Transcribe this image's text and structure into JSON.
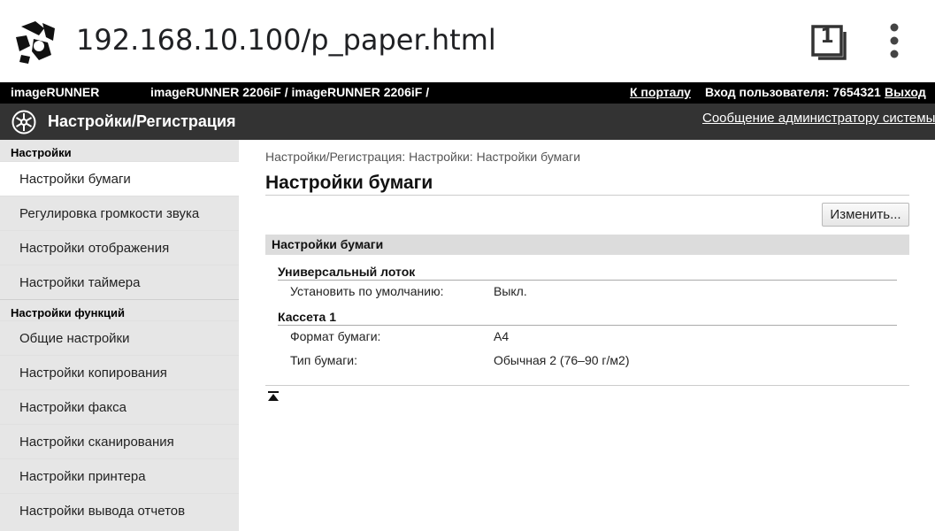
{
  "browser": {
    "url": "192.168.10.100/p_paper.html",
    "tab_count": "1",
    "site_icon": "site-favicon",
    "tabs_icon": "tabs-icon",
    "menu_icon": "more-vert-icon"
  },
  "header": {
    "brand": "imageRUNNER",
    "model": "imageRUNNER 2206iF / imageRUNNER 2206iF /",
    "portal_link": "К порталу",
    "login_info": "Вход пользователя: 7654321",
    "logout_link": "Выход"
  },
  "title_bar": {
    "title": "Настройки/Регистрация",
    "admin_message": "Сообщение администратору системы"
  },
  "sidebar": {
    "group_settings": "Настройки",
    "items_settings": [
      {
        "label": "Настройки бумаги"
      },
      {
        "label": "Регулировка громкости звука"
      },
      {
        "label": "Настройки отображения"
      },
      {
        "label": "Настройки таймера"
      }
    ],
    "group_functions": "Настройки функций",
    "items_functions": [
      {
        "label": "Общие настройки"
      },
      {
        "label": "Настройки копирования"
      },
      {
        "label": "Настройки факса"
      },
      {
        "label": "Настройки сканирования"
      },
      {
        "label": "Настройки принтера"
      },
      {
        "label": "Настройки вывода отчетов"
      }
    ]
  },
  "main": {
    "breadcrumb": "Настройки/Регистрация: Настройки: Настройки бумаги",
    "page_title": "Настройки бумаги",
    "change_button": "Изменить...",
    "section_title": "Настройки бумаги",
    "mp_tray": {
      "title": "Универсальный лоток",
      "default_label": "Установить по умолчанию:",
      "default_value": "Выкл."
    },
    "cassette1": {
      "title": "Кассета 1",
      "size_label": "Формат бумаги:",
      "size_value": "A4",
      "type_label": "Тип бумаги:",
      "type_value": "Обычная 2 (76–90 г/м2)"
    }
  },
  "colors": {
    "header_bg": "#000000",
    "title_bg": "#333333",
    "sidebar_bg": "#e6e6e6",
    "section_bg": "#dcdcdc"
  }
}
